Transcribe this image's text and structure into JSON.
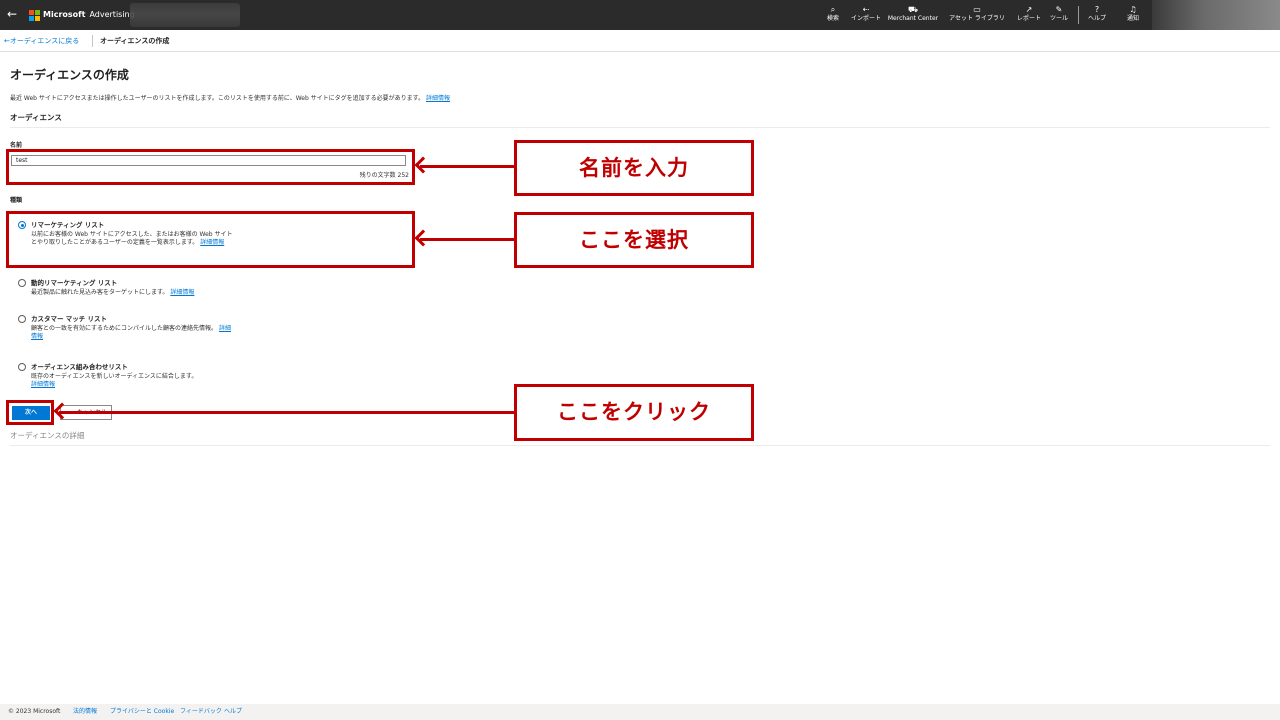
{
  "topbar": {
    "back_icon": "back-arrow-icon",
    "brand_name": "Microsoft",
    "product_name": "Advertising",
    "nav": [
      {
        "label": "検索",
        "icon": "search-icon",
        "glyph": "⌕"
      },
      {
        "label": "インポート",
        "icon": "import-icon",
        "glyph": "⇠"
      },
      {
        "label": "Merchant Center",
        "icon": "cart-icon",
        "glyph": "⛟"
      },
      {
        "label": "アセット ライブラリ",
        "icon": "library-icon",
        "glyph": "▭"
      },
      {
        "label": "レポート",
        "icon": "report-icon",
        "glyph": "↗"
      },
      {
        "label": "ツール",
        "icon": "wrench-icon",
        "glyph": "✎"
      },
      {
        "label": "ヘルプ",
        "icon": "help-icon",
        "glyph": "?"
      },
      {
        "label": "通知",
        "icon": "bell-icon",
        "glyph": "♫"
      }
    ],
    "logo_colors": [
      "#f25022",
      "#7fba00",
      "#00a4ef",
      "#ffb900"
    ]
  },
  "breadcrumb": {
    "back_link": "←オーディエンスに戻る",
    "current": "オーディエンスの作成"
  },
  "page": {
    "title": "オーディエンスの作成",
    "description": "最近 Web サイトにアクセスまたは操作したユーザーのリストを作成します。このリストを使用する前に、Web サイトにタグを追加する必要があります。",
    "description_link": "詳細情報",
    "section_title": "オーディエンス",
    "name_label": "名前",
    "name_value": "test",
    "char_count": "残りの文字数 252",
    "type_label": "種類",
    "options": [
      {
        "title": "リマーケティング リスト",
        "desc": "以前にお客様の Web サイトにアクセスした、またはお客様の Web サイトとやり取りしたことがあるユーザーの定義を一覧表示します。",
        "link": "詳細情報",
        "checked": true
      },
      {
        "title": "動的リマーケティング リスト",
        "desc": "最近製品に触れた見込み客をターゲットにします。",
        "link": "詳細情報",
        "checked": false
      },
      {
        "title": "カスタマー マッチ リスト",
        "desc": "顧客との一致を有効にするためにコンパイルした顧客の連絡先情報。",
        "link": "詳細情報",
        "checked": false
      },
      {
        "title": "オーディエンス組み合わせリスト",
        "desc": "既存のオーディエンスを新しいオーディエンスに結合します。",
        "link": "詳細情報",
        "checked": false
      }
    ],
    "next_button": "次へ",
    "cancel_button": "キャンセル",
    "details_label": "オーディエンスの詳細"
  },
  "annotations": {
    "callout_name": "名前を入力",
    "callout_select": "ここを選択",
    "callout_click": "ここをクリック",
    "color": "#c00000"
  },
  "footer": {
    "copyright": "© 2023 Microsoft",
    "links": [
      "法的情報",
      "プライバシーと Cookie",
      "フィードバック",
      "ヘルプ"
    ]
  },
  "colors": {
    "accent": "#0078d4",
    "topbar": "#2b2b2b",
    "annotation": "#c00000"
  }
}
